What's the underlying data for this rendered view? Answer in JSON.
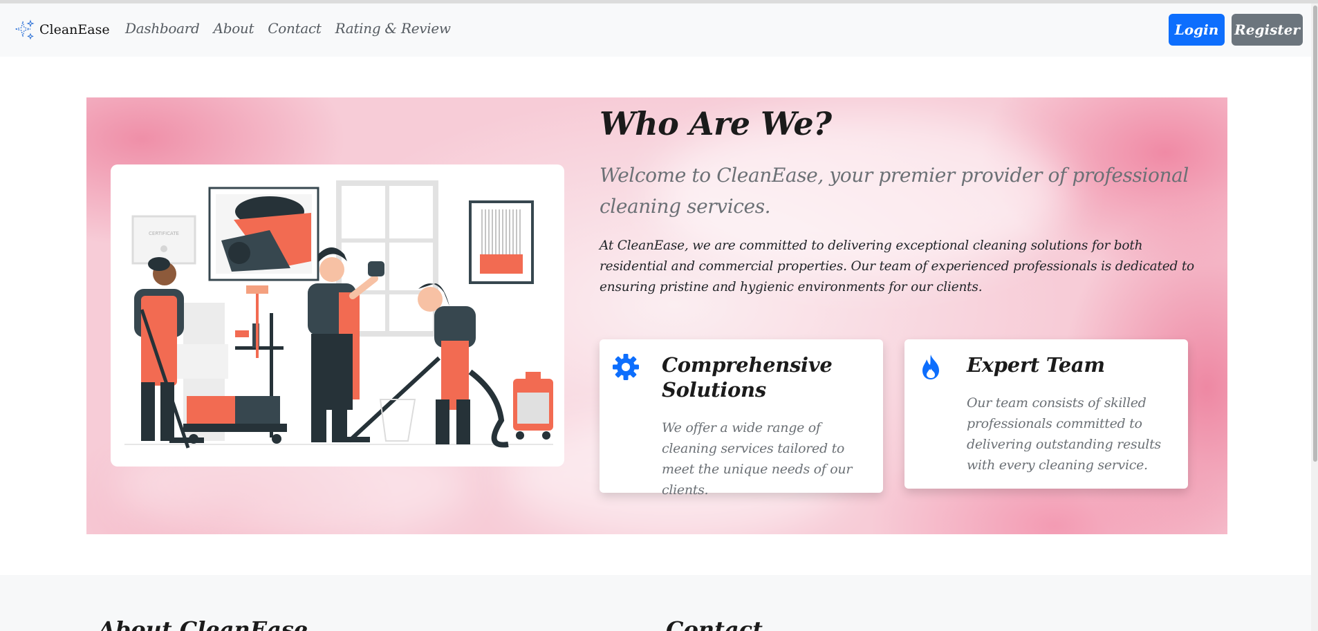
{
  "navbar": {
    "brand": "CleanEase",
    "links": [
      "Dashboard",
      "About",
      "Contact",
      "Rating & Review"
    ],
    "login_label": "Login",
    "register_label": "Register"
  },
  "hero": {
    "title": "Who Are We?",
    "lead": "Welcome to CleanEase, your premier provider of professional cleaning services.",
    "body": "At CleanEase, we are committed to delivering exceptional cleaning solutions for both residential and commercial properties. Our team of experienced professionals is dedicated to ensuring pristine and hygienic environments for our clients.",
    "illustration_certificate": "CERTIFICATE",
    "features": [
      {
        "icon": "gear-icon",
        "title": "Comprehensive Solutions",
        "text": "We offer a wide range of cleaning services tailored to meet the unique needs of our clients."
      },
      {
        "icon": "flame-icon",
        "title": "Expert Team",
        "text": "Our team consists of skilled professionals committed to delivering outstanding results with every cleaning service."
      }
    ]
  },
  "footer": {
    "about_heading": "About CleanEase",
    "contact_heading": "Contact"
  },
  "colors": {
    "primary": "#0d6efd",
    "secondary": "#6c757d",
    "navbar_bg": "#f8f9fa",
    "hero_pink": "#f7ccd7",
    "illustration_accent": "#f26b52",
    "illustration_dark": "#37474f"
  }
}
